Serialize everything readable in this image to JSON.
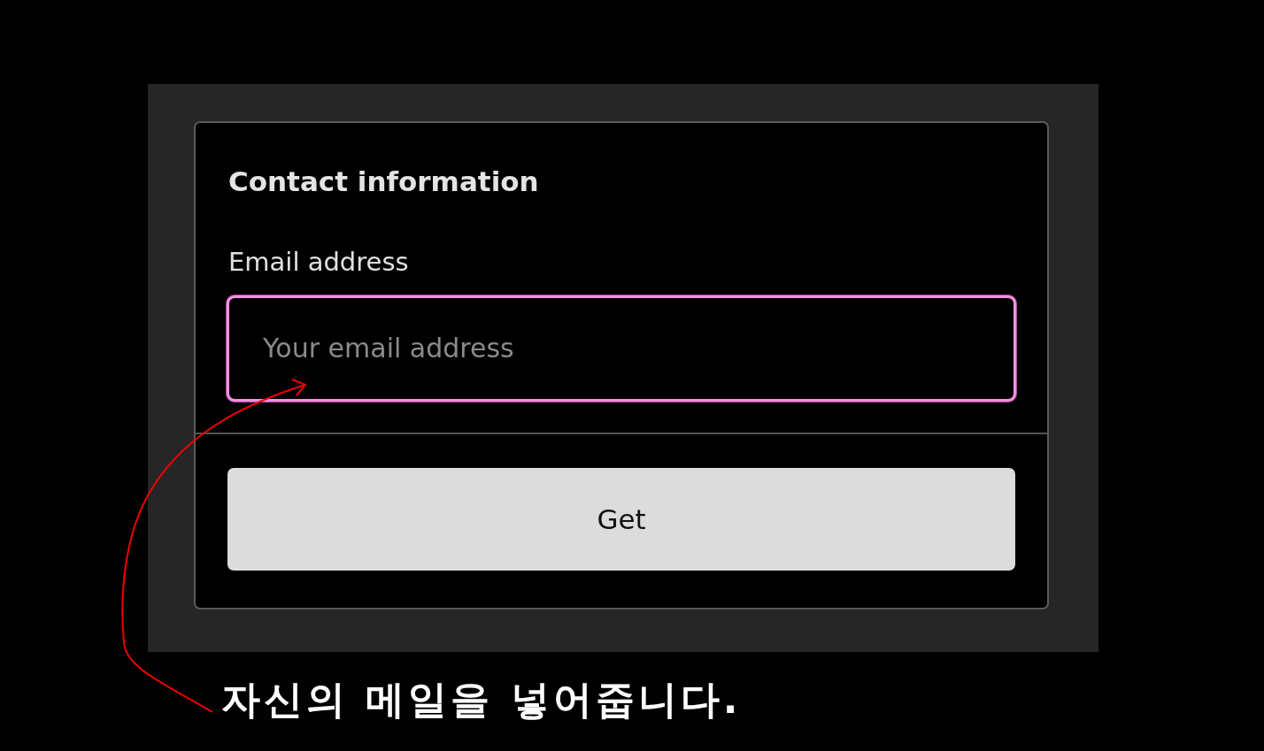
{
  "panel": {
    "title": "Contact information",
    "field": {
      "label": "Email address",
      "placeholder": "Your email address",
      "focused": true
    },
    "button": "Get"
  },
  "annotation": {
    "text": "자신의 메일을 넣어줍니다."
  }
}
